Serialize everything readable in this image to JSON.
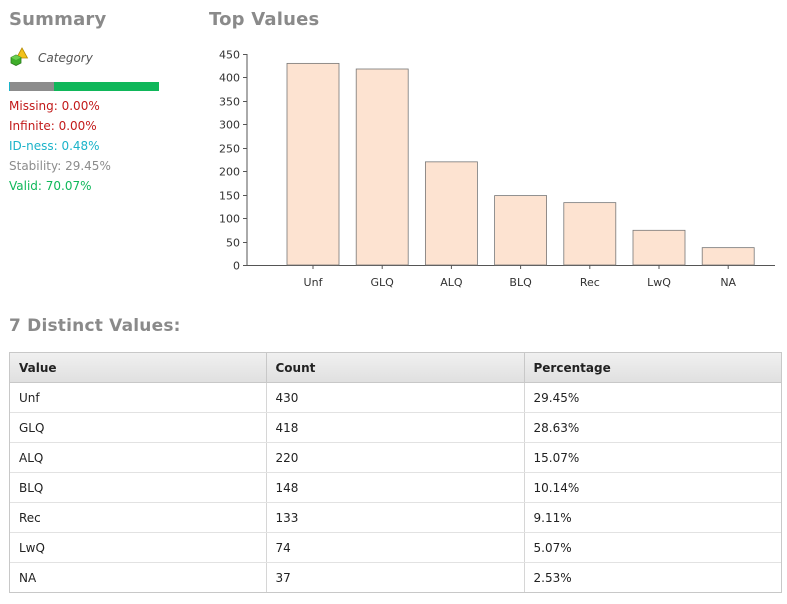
{
  "summary": {
    "title": "Summary",
    "type_label": "Category",
    "type_icon": "category-icon",
    "quality": [
      {
        "name": "missing",
        "fraction": 0.0,
        "color": "#c21a1a"
      },
      {
        "name": "id-ness",
        "fraction": 0.0048,
        "color": "#1bb3c9"
      },
      {
        "name": "stability",
        "fraction": 0.2945,
        "color": "#8c8c8c"
      },
      {
        "name": "valid",
        "fraction": 0.7007,
        "color": "#0fb75a"
      }
    ],
    "stats": [
      {
        "text": "Missing: 0.00%",
        "color": "#c21a1a"
      },
      {
        "text": "Infinite: 0.00%",
        "color": "#c21a1a"
      },
      {
        "text": "ID-ness: 0.48%",
        "color": "#1bb3c9"
      },
      {
        "text": "Stability: 29.45%",
        "color": "#8c8c8c"
      },
      {
        "text": "Valid: 70.07%",
        "color": "#0fb75a"
      }
    ]
  },
  "chart_section": {
    "title": "Top Values"
  },
  "chart_data": {
    "type": "bar",
    "categories": [
      "Unf",
      "GLQ",
      "ALQ",
      "BLQ",
      "Rec",
      "LwQ",
      "NA"
    ],
    "values": [
      430,
      418,
      220,
      148,
      133,
      74,
      37
    ],
    "ylim": [
      0,
      450
    ],
    "yticks": [
      0,
      50,
      100,
      150,
      200,
      250,
      300,
      350,
      400,
      450
    ],
    "bar_color": "#fde3d1",
    "bar_stroke": "#777777",
    "grid": false
  },
  "distinct": {
    "title": "7 Distinct Values:",
    "columns": [
      "Value",
      "Count",
      "Percentage"
    ],
    "rows": [
      [
        "Unf",
        "430",
        "29.45%"
      ],
      [
        "GLQ",
        "418",
        "28.63%"
      ],
      [
        "ALQ",
        "220",
        "15.07%"
      ],
      [
        "BLQ",
        "148",
        "10.14%"
      ],
      [
        "Rec",
        "133",
        "9.11%"
      ],
      [
        "LwQ",
        "74",
        "5.07%"
      ],
      [
        "NA",
        "37",
        "2.53%"
      ]
    ]
  }
}
